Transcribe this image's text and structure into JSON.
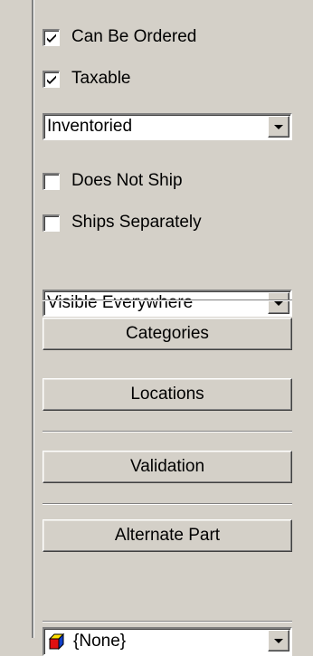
{
  "checkboxes": {
    "can_be_ordered": {
      "label": "Can Be Ordered",
      "checked": true
    },
    "taxable": {
      "label": "Taxable",
      "checked": true
    },
    "does_not_ship": {
      "label": "Does Not Ship",
      "checked": false
    },
    "ships_separately": {
      "label": "Ships Separately",
      "checked": false
    }
  },
  "combos": {
    "inventory_type": {
      "value": "Inventoried"
    },
    "visibility": {
      "value": "Visible Everywhere"
    },
    "alternate_part": {
      "value": "{None}",
      "icon": "colored-cube-icon"
    }
  },
  "buttons": {
    "categories": "Categories",
    "locations": "Locations",
    "validation": "Validation",
    "alternate_part": "Alternate Part"
  }
}
